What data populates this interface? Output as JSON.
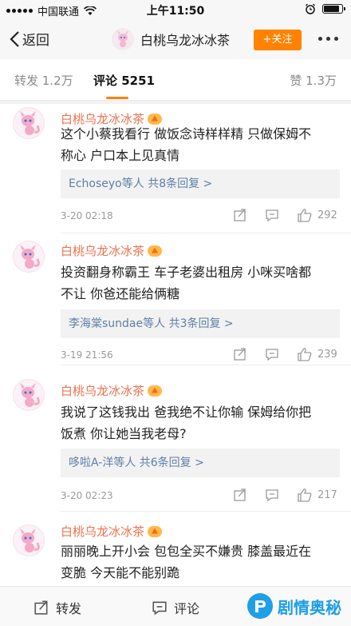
{
  "status_bar": {
    "carrier": "中国联通",
    "time": "上午11:50"
  },
  "nav": {
    "back_label": "返回",
    "title": "白桃乌龙冰冰茶",
    "follow_label": "+关注"
  },
  "tabs": {
    "repost": "转发 1.2万",
    "comment": "评论 5251",
    "like": "赞 1.3万"
  },
  "comments": [
    {
      "author": "白桃乌龙冰冰茶",
      "text_line1": "这个小蔡我看行 做饭念诗样样精 只做保姆不",
      "text_line2": "称心 户口本上见真情",
      "replies": "Echoseyo等人 共8条回复 >",
      "time": "3-20 02:18",
      "likes": "292"
    },
    {
      "author": "白桃乌龙冰冰茶",
      "text_line1": "投资翻身称霸王 车子老婆出租房 小咪买啥都",
      "text_line2": "不让 你爸还能给俩糖",
      "replies": "李海棠sundae等人 共3条回复 >",
      "time": "3-19 21:56",
      "likes": "239"
    },
    {
      "author": "白桃乌龙冰冰茶",
      "text_line1": "我说了这钱我出 爸我绝不让你输 保姆给你把",
      "text_line2": "饭煮 你让她当我老母?",
      "replies": "哆啦A-洋等人 共6条回复 >",
      "time": "3-20 02:23",
      "likes": "217"
    },
    {
      "author": "白桃乌龙冰冰茶",
      "text_line1": "丽丽晚上开小会 包包全买不嫌贵 膝盖最近在",
      "text_line2": "变脆 今天能不能别跪"
    }
  ],
  "bottom_bar": {
    "repost": "转发",
    "comment": "评论"
  },
  "watermark": "剧情奥秘",
  "colors": {
    "accent": "#ff8200",
    "author": "#eb7350",
    "reply_link": "#5d7fa8",
    "watermark": "#1e9fe6"
  }
}
